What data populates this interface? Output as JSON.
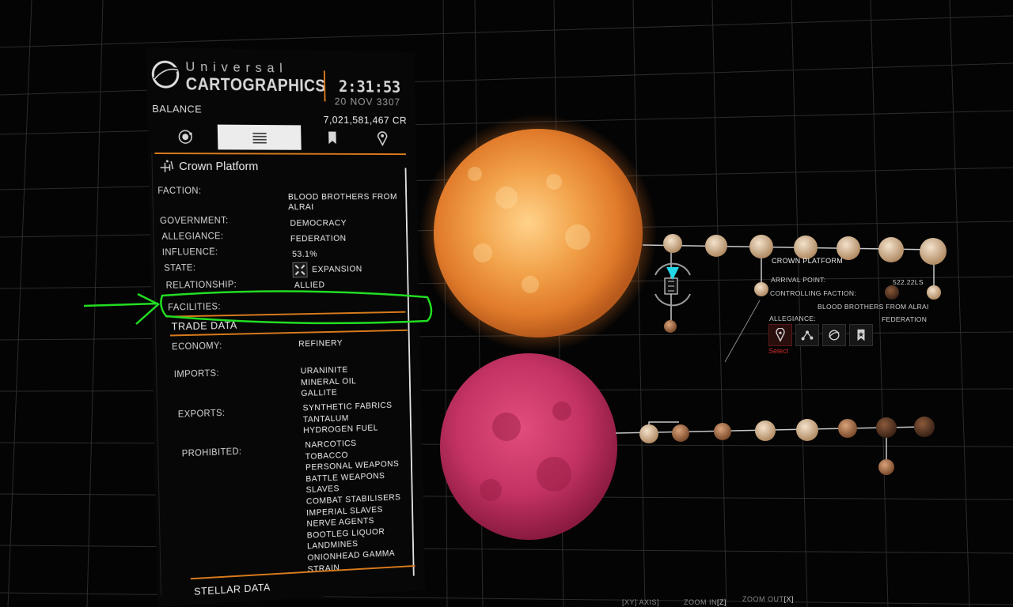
{
  "header": {
    "brand_top": "Universal",
    "brand_main": "CARTOGRAPHICS",
    "time": "2:31:53",
    "date": "20 NOV 3307",
    "balance_label": "BALANCE",
    "balance_value": "7,021,581,467 CR"
  },
  "tabs": [
    {
      "icon": "system-orbit-icon",
      "active": false
    },
    {
      "icon": "list-lines-icon",
      "active": true
    },
    {
      "icon": "bookmark-icon",
      "active": false
    },
    {
      "icon": "navigation-pin-icon",
      "active": false
    }
  ],
  "station": {
    "name": "Crown Platform",
    "faction_label": "FACTION:",
    "faction_line1": "BLOOD BROTHERS FROM",
    "faction_line2": "ALRAI",
    "government_label": "GOVERNMENT:",
    "government": "DEMOCRACY",
    "allegiance_label": "ALLEGIANCE:",
    "allegiance": "FEDERATION",
    "influence_label": "INFLUENCE:",
    "influence": "53.1%",
    "state_label": "STATE:",
    "state": "EXPANSION",
    "relationship_label": "RELATIONSHIP:",
    "relationship": "ALLIED",
    "facilities_label": "FACILITIES:"
  },
  "trade": {
    "title": "TRADE DATA",
    "economy_label": "ECONOMY:",
    "economy": "REFINERY",
    "imports_label": "IMPORTS:",
    "imports": [
      "URANINITE",
      "MINERAL OIL",
      "GALLITE"
    ],
    "exports_label": "EXPORTS:",
    "exports": [
      "SYNTHETIC FABRICS",
      "TANTALUM",
      "HYDROGEN FUEL"
    ],
    "prohibited_label": "PROHIBITED:",
    "prohibited": [
      "NARCOTICS",
      "TOBACCO",
      "PERSONAL WEAPONS",
      "BATTLE WEAPONS",
      "SLAVES",
      "COMBAT STABILISERS",
      "IMPERIAL SLAVES",
      "NERVE AGENTS",
      "BOOTLEG LIQUOR",
      "LANDMINES",
      "ONIONHEAD GAMMA",
      "STRAIN"
    ]
  },
  "stellar": {
    "title": "STELLAR DATA"
  },
  "info_card": {
    "name": "CROWN PLATFORM",
    "arrival_label": "ARRIVAL POINT:",
    "arrival_value": "522.22LS",
    "controlling_label": "CONTROLLING FACTION:",
    "controlling_value": "BLOOD BROTHERS FROM ALRAI",
    "allegiance_label": "ALLEGIANCE:",
    "allegiance_value": "FEDERATION",
    "select_label": "Select",
    "actions": [
      "target-icon",
      "route-icon",
      "orbit-view-icon",
      "bookmark-star-icon"
    ]
  },
  "hints": {
    "axis": "[XY] AXIS]",
    "zoom_in": "ZOOM IN",
    "zoom_in_key": "[Z]",
    "zoom_out": "ZOOM OUT",
    "zoom_out_key": "[X]"
  },
  "colors": {
    "accent": "#d87a1c",
    "annotation": "#22dd22",
    "select": "#cc2a2a",
    "panel_bg": "#070707"
  }
}
